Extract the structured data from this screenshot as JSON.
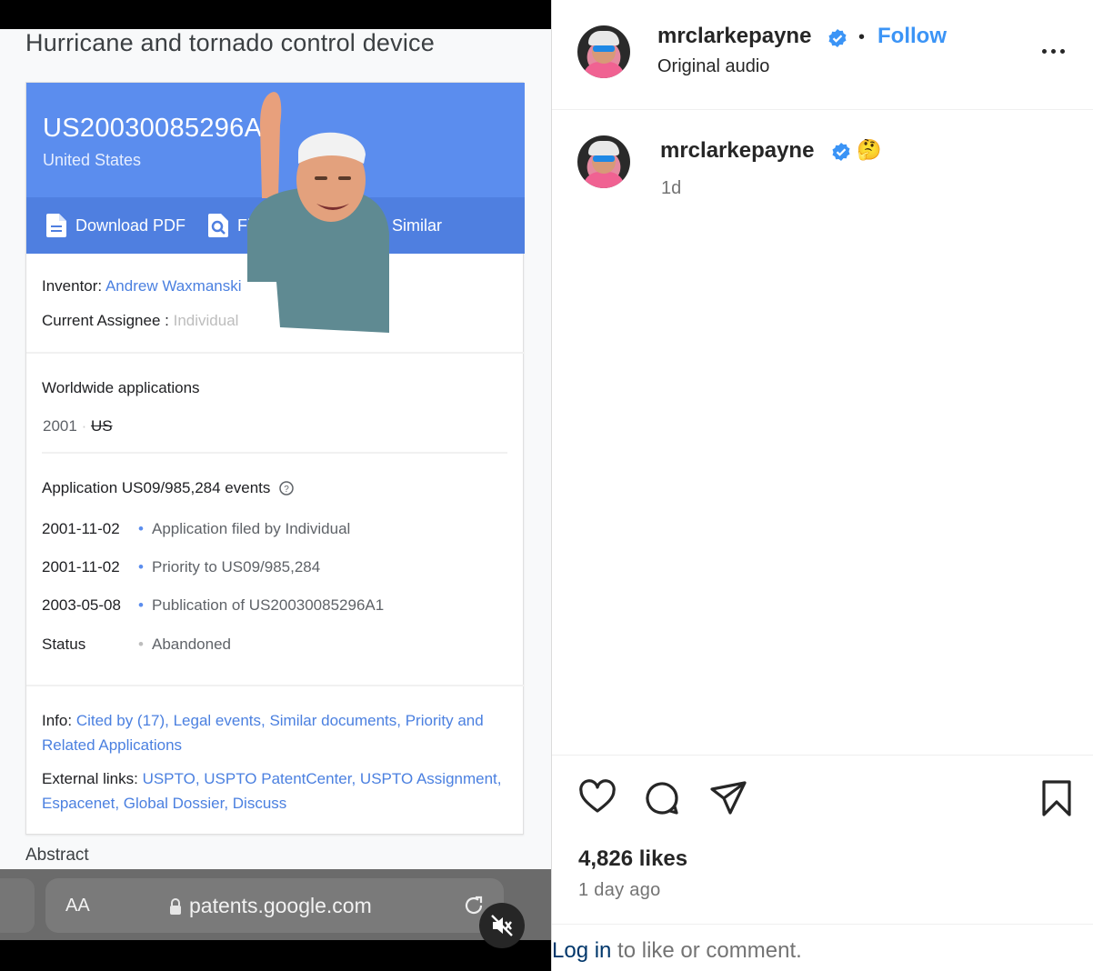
{
  "video": {
    "patent_title": "Hurricane and tornado control device",
    "patent_number": "US20030085296A1",
    "country": "United States",
    "actions": {
      "download": "Download PDF",
      "find": "Find P",
      "similar": "Similar"
    },
    "inventor_label": "Inventor:",
    "inventor_name": "Andrew Waxmanski",
    "assignee_label": "Current Assignee :",
    "assignee_value": "Individual",
    "worldwide_heading": "Worldwide applications",
    "worldwide_year": "2001",
    "worldwide_country": "US",
    "events_heading": "Application US09/985,284 events",
    "events": [
      {
        "date": "2001-11-02",
        "desc": "Application filed by Individual"
      },
      {
        "date": "2001-11-02",
        "desc": "Priority to US09/985,284"
      },
      {
        "date": "2003-05-08",
        "desc": "Publication of US20030085296A1"
      },
      {
        "date": "Status",
        "desc": "Abandoned"
      }
    ],
    "info_label": "Info:",
    "info_links": "Cited by (17), Legal events, Similar documents, Priority and Related Applications",
    "external_label": "External links:",
    "external_links": "USPTO, USPTO PatentCenter, USPTO Assignment, Espacenet, Global Dossier, Discuss",
    "abstract_heading": "Abstract",
    "browser": {
      "text_size": "AA",
      "domain": "patents.google.com"
    }
  },
  "post": {
    "username": "mrclarkepayne",
    "separator": "•",
    "follow_label": "Follow",
    "audio_label": "Original audio",
    "caption_emoji": "🤔",
    "caption_time": "1d",
    "likes": "4,826 likes",
    "posted_ago": "1 day ago",
    "login_link": "Log in",
    "login_suffix": " to like or comment."
  },
  "colors": {
    "accent_blue": "#3b94f6",
    "patent_header": "#5b8dee",
    "link_blue": "#4b80e0"
  },
  "icons": [
    "document-icon",
    "search-doc-icon",
    "sigma-icon",
    "lock-icon",
    "reload-icon",
    "mute-icon",
    "verified-icon",
    "more-icon",
    "heart-icon",
    "comment-icon",
    "share-icon",
    "bookmark-icon"
  ]
}
